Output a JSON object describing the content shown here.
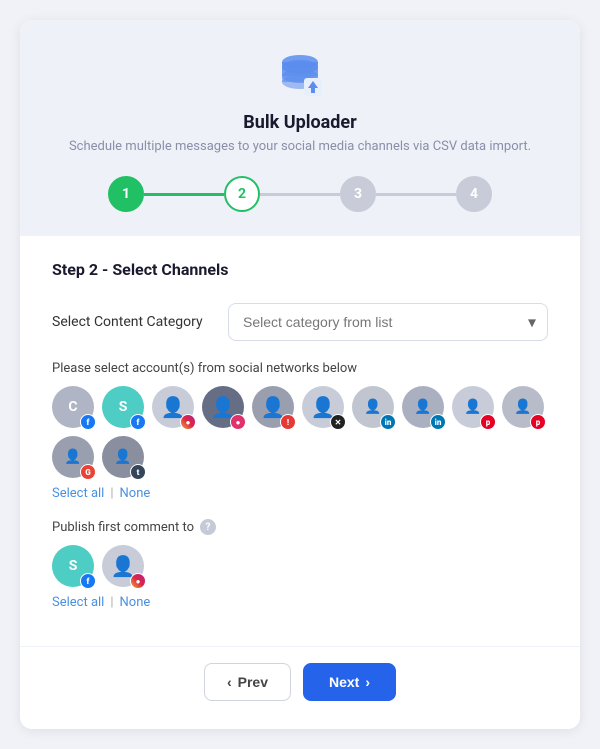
{
  "header": {
    "title": "Bulk Uploader",
    "subtitle": "Schedule multiple messages to your social media channels via CSV data import."
  },
  "stepper": {
    "steps": [
      {
        "number": "1",
        "state": "completed"
      },
      {
        "number": "2",
        "state": "active"
      },
      {
        "number": "3",
        "state": "inactive"
      },
      {
        "number": "4",
        "state": "inactive"
      }
    ]
  },
  "step_label": "Step 2 - Select Channels",
  "form": {
    "category_label": "Select Content Category",
    "category_placeholder": "Select category from list"
  },
  "accounts": {
    "section_label": "Please select account(s) from social networks below",
    "select_all": "Select all",
    "none": "None"
  },
  "publish": {
    "label": "Publish first comment to",
    "select_all": "Select all",
    "none": "None"
  },
  "footer": {
    "prev_label": "Prev",
    "next_label": "Next"
  }
}
